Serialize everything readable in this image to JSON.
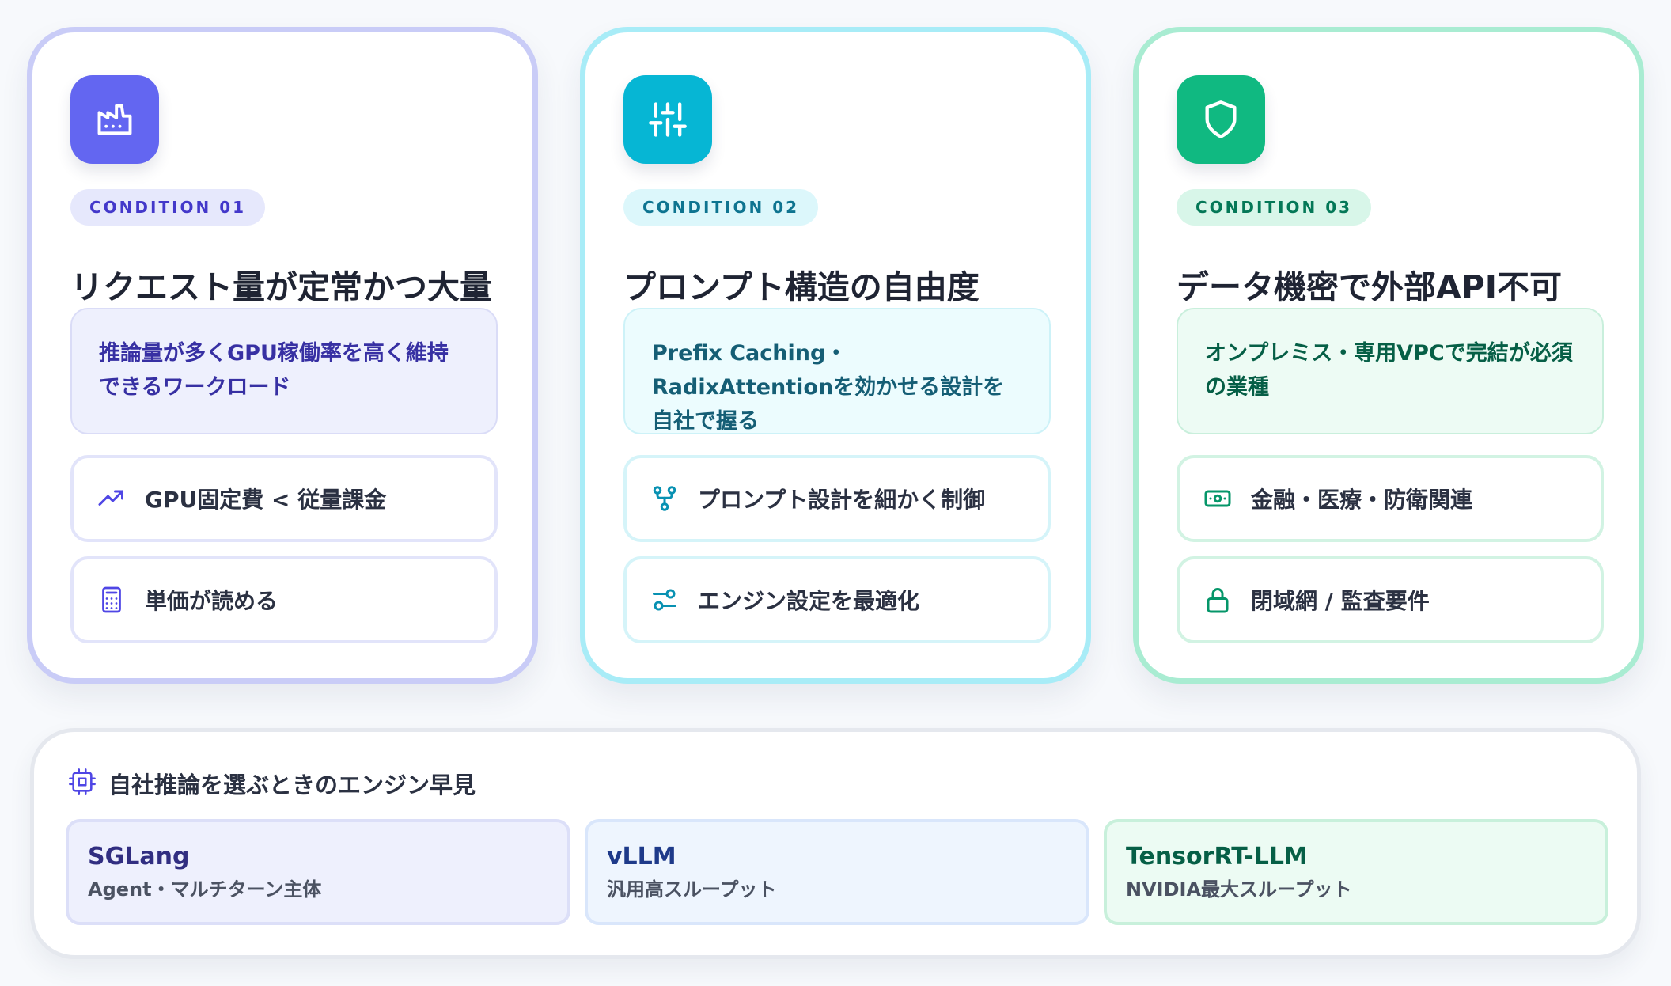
{
  "conditions": [
    {
      "badge": "CONDITION 01",
      "title": "リクエスト量が定常かつ大量",
      "description": "推論量が多くGPU稼働率を高く維持できるワークロード",
      "icon": "factory-icon",
      "features": [
        {
          "icon": "trending-up-icon",
          "label": "GPU固定費 < 従量課金"
        },
        {
          "icon": "calculator-icon",
          "label": "単価が読める"
        }
      ]
    },
    {
      "badge": "CONDITION 02",
      "title": "プロンプト構造の自由度",
      "description": "Prefix Caching・RadixAttentionを効かせる設計を自社で握る",
      "icon": "sliders-icon",
      "features": [
        {
          "icon": "git-fork-icon",
          "label": "プロンプト設計を細かく制御"
        },
        {
          "icon": "settings-sliders-icon",
          "label": "エンジン設定を最適化"
        }
      ]
    },
    {
      "badge": "CONDITION 03",
      "title": "データ機密で外部API不可",
      "description": "オンプレミス・専用VPCで完結が必須の業種",
      "icon": "shield-icon",
      "features": [
        {
          "icon": "banknote-icon",
          "label": "金融・医療・防衛関連"
        },
        {
          "icon": "lock-icon",
          "label": "閉域網 / 監査要件"
        }
      ]
    }
  ],
  "engines": {
    "title": "自社推論を選ぶときのエンジン早見",
    "icon": "cpu-icon",
    "items": [
      {
        "name": "SGLang",
        "desc": "Agent・マルチターン主体"
      },
      {
        "name": "vLLM",
        "desc": "汎用高スループット"
      },
      {
        "name": "TensorRT-LLM",
        "desc": "NVIDIA最大スループット"
      }
    ]
  },
  "colors": {
    "indigo": "#6366f1",
    "cyan": "#06b6d4",
    "emerald": "#10b981"
  }
}
